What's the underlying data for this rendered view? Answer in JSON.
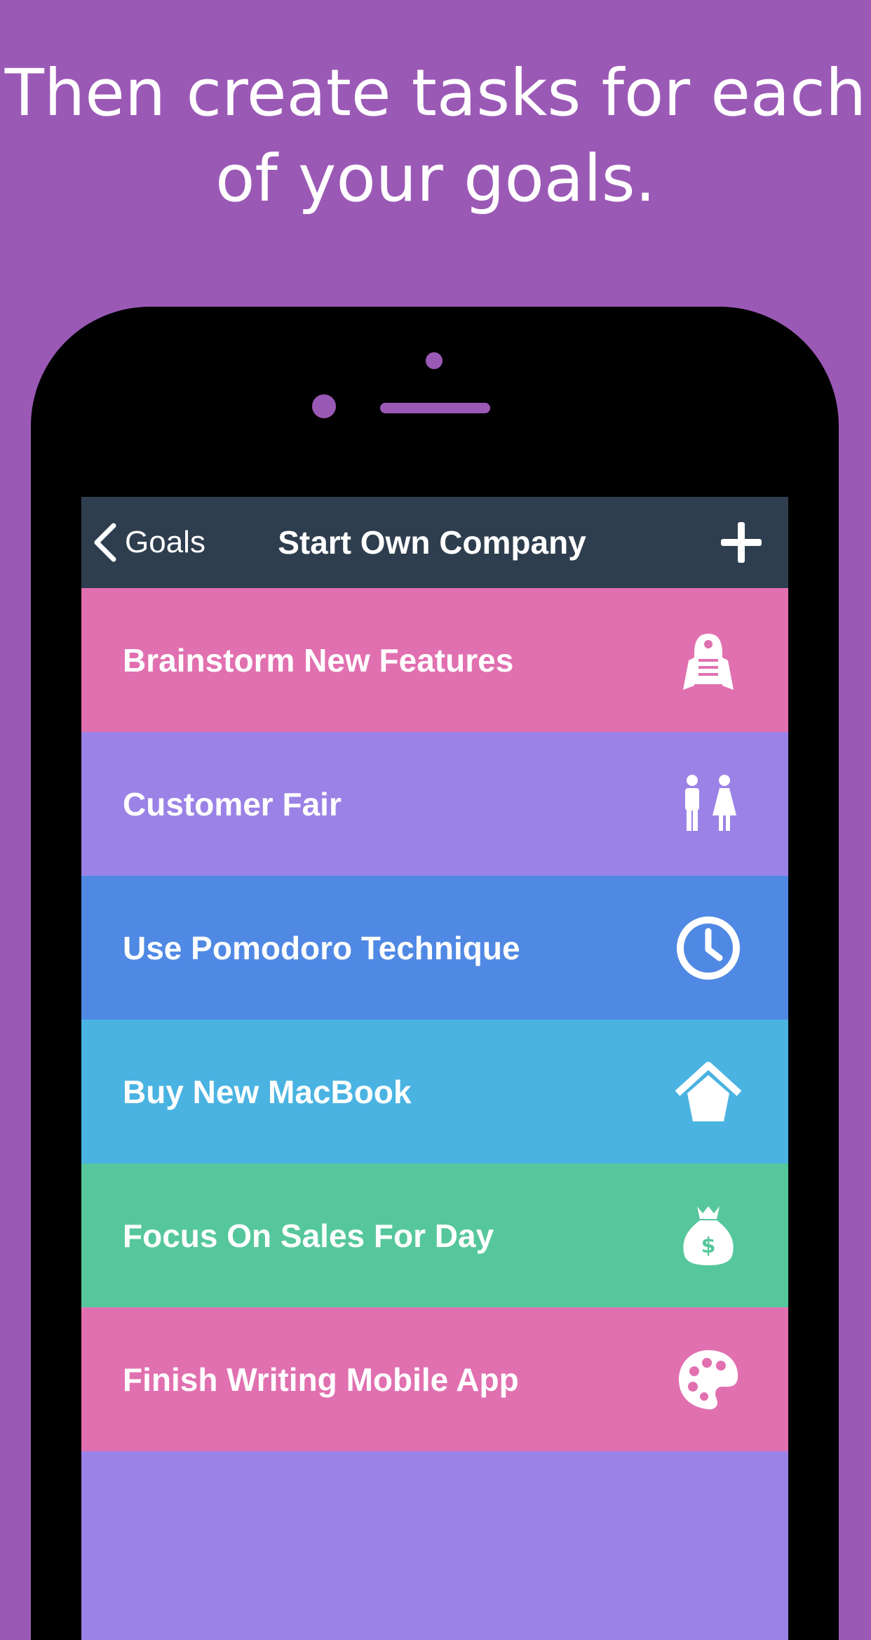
{
  "headline": {
    "line1": "Then create tasks for each",
    "line2": "of your goals."
  },
  "navbar": {
    "back_label": "Goals",
    "title": "Start Own Company",
    "add_icon": "plus-icon",
    "back_icon": "chevron-left-icon"
  },
  "colors": {
    "background": "#9b59b6",
    "navbar": "#2e3e4e",
    "pink": "#e170b0",
    "lavender": "#9b82e6",
    "blue": "#5089e4",
    "sky": "#4ab3e1",
    "green": "#56c79d"
  },
  "tasks": [
    {
      "label": "Brainstorm New Features",
      "color": "#e170b0",
      "icon": "robot-icon"
    },
    {
      "label": "Customer Fair",
      "color": "#9b82e6",
      "icon": "people-icon"
    },
    {
      "label": "Use Pomodoro Technique",
      "color": "#5089e4",
      "icon": "clock-icon"
    },
    {
      "label": "Buy New MacBook",
      "color": "#4ab3e1",
      "icon": "house-icon"
    },
    {
      "label": "Focus On Sales For Day",
      "color": "#56c79d",
      "icon": "money-bag-icon"
    },
    {
      "label": "Finish Writing Mobile App",
      "color": "#e170b0",
      "icon": "palette-icon"
    }
  ]
}
